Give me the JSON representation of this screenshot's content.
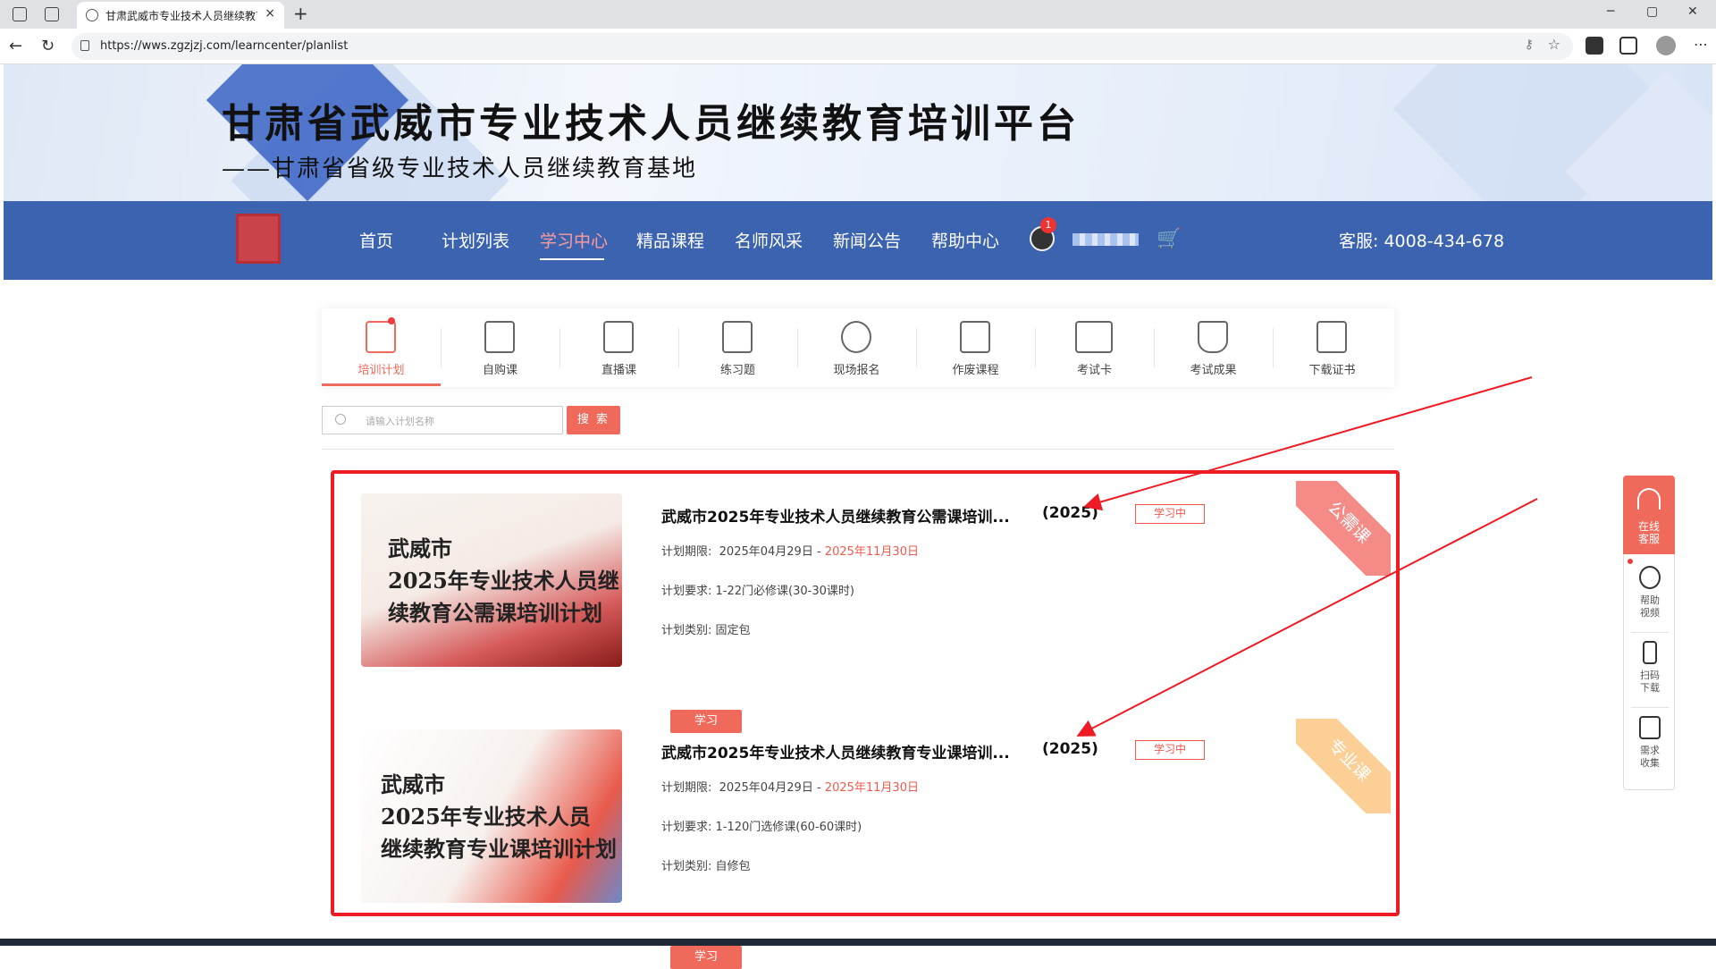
{
  "browser": {
    "tab_title": "甘肃武威市专业技术人员继续教育",
    "url": "https://wws.zgzjzj.com/learncenter/planlist",
    "new_tab": "+",
    "close": "×",
    "minimize": "─",
    "maximize": "▢",
    "close_window": "✕",
    "back": "←",
    "reload": "↻",
    "menu": "⋯"
  },
  "banner": {
    "title": "甘肃省武威市专业技术人员继续教育培训平台",
    "subtitle": "——甘肃省省级专业技术人员继续教育基地"
  },
  "nav": {
    "items": [
      "首页",
      "计划列表",
      "学习中心",
      "精品课程",
      "名师风采",
      "新闻公告",
      "帮助中心"
    ],
    "active_index": 2,
    "user_badge": "1",
    "service": "客服: 4008-434-678"
  },
  "subtabs": [
    {
      "label": "培训计划",
      "icon": "calendar-check-icon",
      "active": true
    },
    {
      "label": "自购课",
      "icon": "doc-plus-icon"
    },
    {
      "label": "直播课",
      "icon": "play-book-icon"
    },
    {
      "label": "练习题",
      "icon": "notebook-pen-icon"
    },
    {
      "label": "现场报名",
      "icon": "user-check-icon"
    },
    {
      "label": "作废课程",
      "icon": "doc-cancel-icon"
    },
    {
      "label": "考试卡",
      "icon": "id-card-icon"
    },
    {
      "label": "考试成果",
      "icon": "trophy-icon"
    },
    {
      "label": "下载证书",
      "icon": "certificate-icon"
    }
  ],
  "search": {
    "placeholder": "请输入计划名称",
    "button": "搜 索"
  },
  "plans": [
    {
      "thumb_title_1": "武威市",
      "thumb_title_2": "2025年专业技术人员继",
      "thumb_title_3": "续教育公需课培训计划",
      "title": "武威市2025年专业技术人员继续教育公需课培训...",
      "year": "(2025)",
      "status": "学习中",
      "period_label": "计划期限:",
      "period_start": "2025年04月29日 -",
      "period_end": "2025年11月30日",
      "requirement": "计划要求: 1-22门必修课(30-30课时)",
      "category": "计划类别: 固定包",
      "button": "学习",
      "ribbon": "公需课",
      "ribbon_color": "#f58b86"
    },
    {
      "thumb_title_1": "武威市",
      "thumb_title_2": "2025年专业技术人员",
      "thumb_title_3": "继续教育专业课培训计划",
      "title": "武威市2025年专业技术人员继续教育专业课培训...",
      "year": "(2025)",
      "status": "学习中",
      "period_label": "计划期限:",
      "period_start": "2025年04月29日 -",
      "period_end": "2025年11月30日",
      "requirement": "计划要求: 1-120门选修课(60-60课时)",
      "category": "计划类别: 自修包",
      "button": "学习",
      "ribbon": "专业课",
      "ribbon_color": "#fbcf95"
    }
  ],
  "float_panel": {
    "online_service": "在线\n客服",
    "help_video": "帮助\n视频",
    "scan_download": "扫码\n下载",
    "feedback": "需求\n收集"
  },
  "colors": {
    "accent": "#f06a5c",
    "nav_bg": "#3b63af",
    "highlight": "#ee1b24"
  }
}
